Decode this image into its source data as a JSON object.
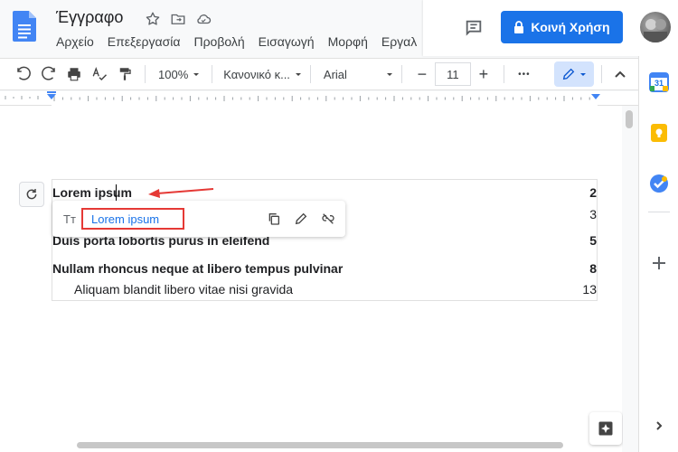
{
  "titlebar": {
    "doc_title": "Έγγραφο",
    "star_icon": "star-outline-icon",
    "move_icon": "move-to-folder-icon",
    "cloud_icon": "cloud-saved-icon",
    "menu": [
      "Αρχείο",
      "Επεξεργασία",
      "Προβολή",
      "Εισαγωγή",
      "Μορφή",
      "Εργαλ"
    ],
    "share_label": "Κοινή Χρήση",
    "accent_color": "#1a73e8"
  },
  "toolbar": {
    "zoom": "100%",
    "style": "Κανονικό κ...",
    "font": "Arial",
    "font_size": "11",
    "minus": "−",
    "plus": "+",
    "more": "•••"
  },
  "toc": {
    "rows": [
      {
        "label": "Lorem ipsum",
        "page": "2",
        "level": 1
      },
      {
        "label": "",
        "page": "3",
        "level": 2
      },
      {
        "label": "Duis porta lobortis purus in eleifend",
        "page": "5",
        "level": 1
      },
      {
        "label": "Nullam rhoncus neque at libero tempus pulvinar",
        "page": "8",
        "level": 1
      },
      {
        "label": "Aliquam blandit libero vitae nisi gravida",
        "page": "13",
        "level": 2
      }
    ]
  },
  "link_popup": {
    "tt_label": "Tт",
    "link_text": "Lorem ipsum",
    "highlight_color": "#e53935"
  },
  "sidepanel": {
    "calendar_label": "31"
  }
}
